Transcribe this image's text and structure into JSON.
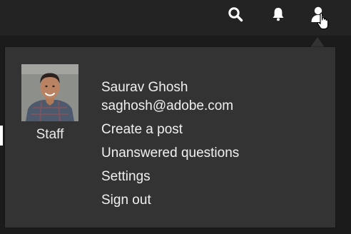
{
  "topbar": {
    "icons": [
      "search-icon",
      "bell-icon",
      "user-icon"
    ]
  },
  "profile_menu": {
    "user": {
      "name": "Saurav Ghosh",
      "email": "saghosh@adobe.com",
      "role": "Staff"
    },
    "items": [
      {
        "label": "Create a post"
      },
      {
        "label": "Unanswered questions"
      },
      {
        "label": "Settings"
      },
      {
        "label": "Sign out"
      }
    ]
  },
  "colors": {
    "page_background": "#1b1b1b",
    "topbar_background": "#232323",
    "menu_background": "#333333",
    "text": "#f0f0f0"
  }
}
